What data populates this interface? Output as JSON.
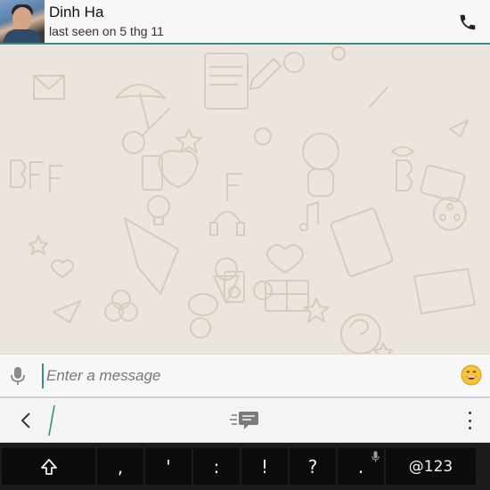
{
  "header": {
    "contact_name": "Dinh Ha",
    "last_seen": "last seen on 5 thg 11",
    "accent_color": "#3b8a86"
  },
  "compose": {
    "placeholder": "Enter a message",
    "value": ""
  },
  "icons": {
    "avatar": "contact-photo",
    "call": "phone-icon",
    "mic": "microphone-icon",
    "emoji": "smiley-icon",
    "back": "chevron-left-icon",
    "chats": "chat-list-icon",
    "overflow": "overflow-menu-icon",
    "shift": "shift-arrow-icon"
  },
  "keyboard": {
    "keys": [
      ",",
      "'",
      ":",
      "!",
      "?",
      "."
    ],
    "num_label": "@123"
  }
}
